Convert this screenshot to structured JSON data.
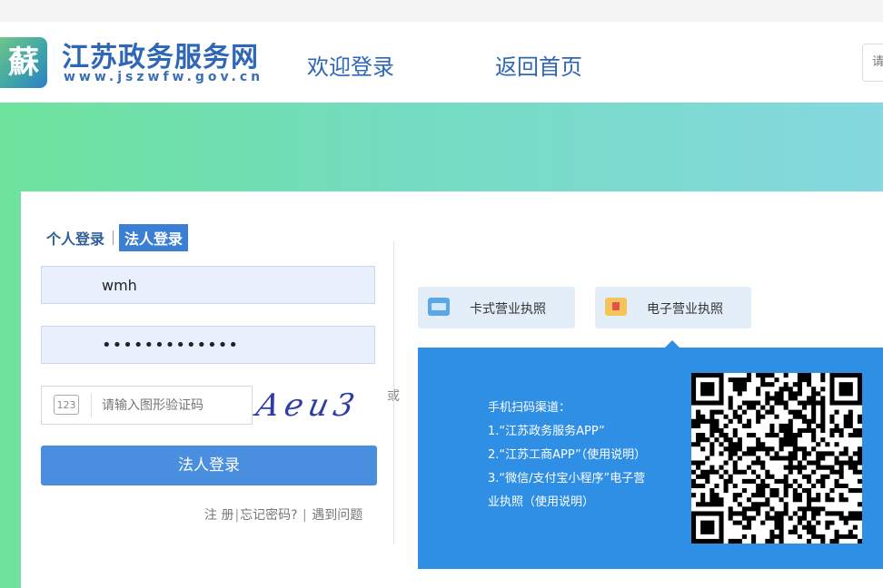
{
  "header": {
    "logo_char": "蘇",
    "site_name": "江苏政务服务网",
    "site_url": "www.jszwfw.gov.cn",
    "nav_welcome": "欢迎登录",
    "nav_home": "返回首页",
    "search_placeholder": "请输入"
  },
  "login": {
    "tabs": [
      "个人登录",
      "法人登录"
    ],
    "active_tab": "法人登录",
    "username_value": "wmh",
    "password_value": "•••••••••••••",
    "captcha_icon_text": "123",
    "captcha_placeholder": "请输入图形验证码",
    "captcha_image_text": "Aeu3",
    "or_text": "或",
    "submit_label": "法人登录",
    "links": {
      "register": "注 册",
      "forgot": "忘记密码?",
      "problem": "遇到问题"
    }
  },
  "license": {
    "card_tab": "卡式营业执照",
    "e_tab": "电子营业执照",
    "qr_lines": [
      "手机扫码渠道：",
      "1.“江苏政务服务APP”",
      "2.“江苏工商APP”（使用说明）",
      "3.“微信/支付宝小程序”电子营",
      "业执照（使用说明）"
    ]
  },
  "colors": {
    "brand_blue": "#2f67b8",
    "button_blue": "#4a8ee0",
    "panel_blue": "#2f8fe5",
    "hero_green": "#6ee39d",
    "hero_cyan": "#84d8de"
  }
}
